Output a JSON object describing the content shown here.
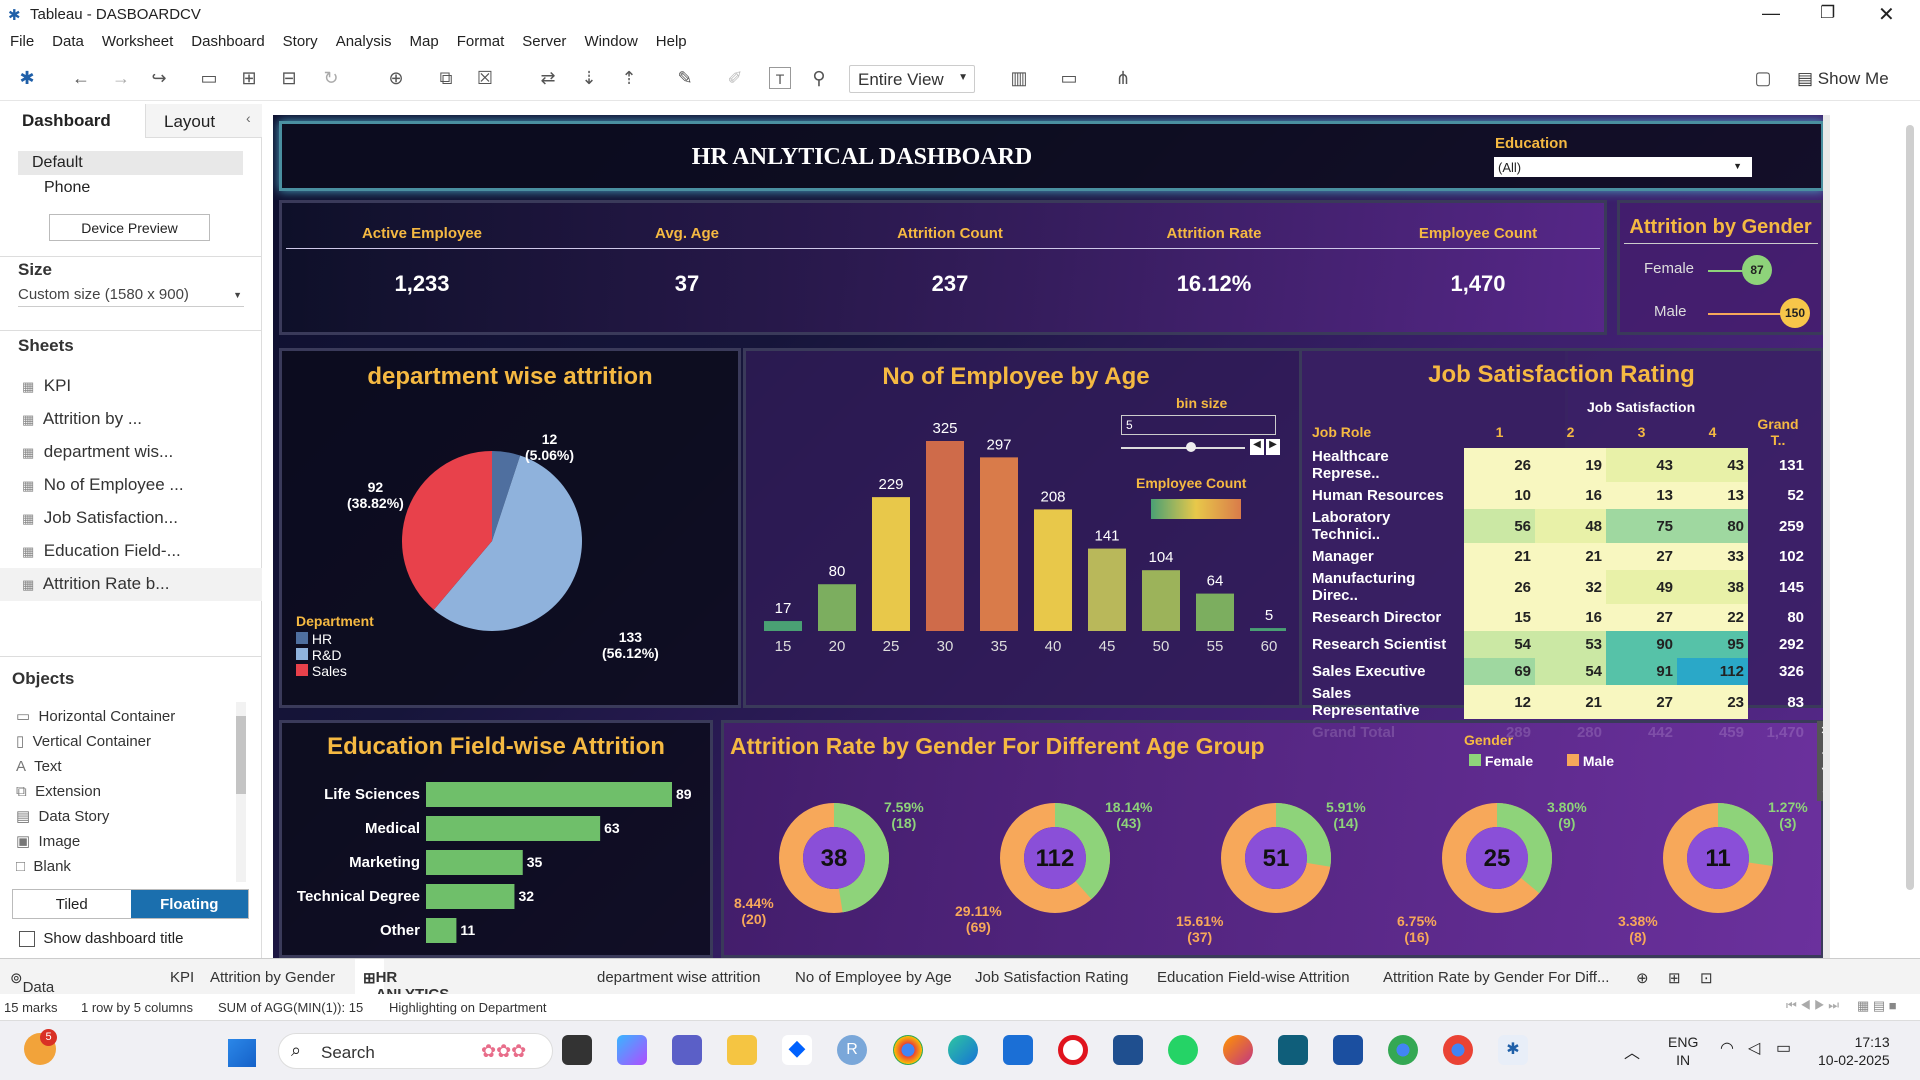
{
  "window": {
    "title": "Tableau - DASBOARDCV"
  },
  "menu": [
    "File",
    "Data",
    "Worksheet",
    "Dashboard",
    "Story",
    "Analysis",
    "Map",
    "Format",
    "Server",
    "Window",
    "Help"
  ],
  "toolbar": {
    "view_select": "Entire View",
    "show_me": "Show Me"
  },
  "left": {
    "tab_dashboard": "Dashboard",
    "tab_layout": "Layout",
    "device_default": "Default",
    "device_phone": "Phone",
    "device_preview": "Device Preview",
    "size_title": "Size",
    "size_value": "Custom size (1580 x 900)",
    "sheets_title": "Sheets",
    "sheets": [
      "KPI",
      "Attrition by ...",
      "department wis...",
      "No of Employee ...",
      "Job Satisfaction...",
      "Education Field-...",
      "Attrition Rate b..."
    ],
    "objects_title": "Objects",
    "objects": [
      "Horizontal Container",
      "Vertical Container",
      "Text",
      "Extension",
      "Data Story",
      "Image",
      "Blank"
    ],
    "tiled": "Tiled",
    "floating": "Floating",
    "show_title": "Show dashboard title"
  },
  "dashboard": {
    "title": "HR ANLYTICAL DASHBOARD",
    "education_label": "Education",
    "education_value": "(All)",
    "kpis": [
      {
        "label": "Active Employee",
        "value": "1,233"
      },
      {
        "label": "Avg. Age",
        "value": "37"
      },
      {
        "label": "Attrition Count",
        "value": "237"
      },
      {
        "label": "Attrition Rate",
        "value": "16.12%"
      },
      {
        "label": "Employee Count",
        "value": "1,470"
      }
    ],
    "gender": {
      "title": "Attrition by Gender",
      "female_label": "Female",
      "female_value": "87",
      "male_label": "Male",
      "male_value": "150"
    },
    "dept": {
      "title": "department wise attrition",
      "legend_title": "Department",
      "legend": [
        "HR",
        "R&D",
        "Sales"
      ],
      "labels": [
        {
          "n": "12",
          "p": "(5.06%)"
        },
        {
          "n": "133",
          "p": "(56.12%)"
        },
        {
          "n": "92",
          "p": "(38.82%)"
        }
      ]
    },
    "age": {
      "title": "No of Employee by Age",
      "bin_label": "bin size",
      "bin_value": "5",
      "count_label": "Employee Count"
    },
    "job": {
      "title": "Job Satisfaction Rating",
      "col_group": "Job Satisfaction",
      "col_role": "Job Role",
      "cols": [
        "1",
        "2",
        "3",
        "4",
        "Grand T.."
      ],
      "rows": [
        {
          "role": "Healthcare Represe..",
          "v": [
            "26",
            "19",
            "43",
            "43",
            "131"
          ]
        },
        {
          "role": "Human Resources",
          "v": [
            "10",
            "16",
            "13",
            "13",
            "52"
          ]
        },
        {
          "role": "Laboratory Technici..",
          "v": [
            "56",
            "48",
            "75",
            "80",
            "259"
          ]
        },
        {
          "role": "Manager",
          "v": [
            "21",
            "21",
            "27",
            "33",
            "102"
          ]
        },
        {
          "role": "Manufacturing Direc..",
          "v": [
            "26",
            "32",
            "49",
            "38",
            "145"
          ]
        },
        {
          "role": "Research Director",
          "v": [
            "15",
            "16",
            "27",
            "22",
            "80"
          ]
        },
        {
          "role": "Research Scientist",
          "v": [
            "54",
            "53",
            "90",
            "95",
            "292"
          ]
        },
        {
          "role": "Sales Executive",
          "v": [
            "69",
            "54",
            "91",
            "112",
            "326"
          ]
        },
        {
          "role": "Sales Representative",
          "v": [
            "12",
            "21",
            "27",
            "23",
            "83"
          ]
        }
      ],
      "total": {
        "role": "Grand Total",
        "v": [
          "289",
          "280",
          "442",
          "459",
          "1,470"
        ]
      }
    },
    "edu": {
      "title": "Education Field-wise Attrition"
    },
    "donut": {
      "title": "Attrition Rate by Gender For Different Age Group",
      "legend_title": "Gender",
      "female": "Female",
      "male": "Male",
      "items": [
        {
          "total": "38",
          "f_pct": "7.59%",
          "f_n": "(18)",
          "m_pct": "8.44%",
          "m_n": "(20)",
          "f_share": 0.474
        },
        {
          "total": "112",
          "f_pct": "18.14%",
          "f_n": "(43)",
          "m_pct": "29.11%",
          "m_n": "(69)",
          "f_share": 0.384
        },
        {
          "total": "51",
          "f_pct": "5.91%",
          "f_n": "(14)",
          "m_pct": "15.61%",
          "m_n": "(37)",
          "f_share": 0.275
        },
        {
          "total": "25",
          "f_pct": "3.80%",
          "f_n": "(9)",
          "m_pct": "6.75%",
          "m_n": "(16)",
          "f_share": 0.36
        },
        {
          "total": "11",
          "f_pct": "1.27%",
          "f_n": "(3)",
          "m_pct": "3.38%",
          "m_n": "(8)",
          "f_share": 0.273
        }
      ]
    }
  },
  "chart_data": [
    {
      "type": "bar",
      "title": "No of Employee by Age",
      "categories": [
        "15",
        "20",
        "25",
        "30",
        "35",
        "40",
        "45",
        "50",
        "55",
        "60"
      ],
      "values": [
        17,
        80,
        229,
        325,
        297,
        208,
        141,
        104,
        64,
        5
      ]
    },
    {
      "type": "bar",
      "title": "Education Field-wise Attrition",
      "categories": [
        "Life Sciences",
        "Medical",
        "Marketing",
        "Technical Degree",
        "Other"
      ],
      "values": [
        89,
        63,
        35,
        32,
        11
      ]
    },
    {
      "type": "pie",
      "title": "department wise attrition",
      "categories": [
        "HR",
        "R&D",
        "Sales"
      ],
      "values": [
        12,
        133,
        92
      ]
    }
  ],
  "colors": {
    "orange_title": "#f5b942",
    "female": "#8ed37a",
    "male": "#f7a85a",
    "hr": "#4f6f9f",
    "rd": "#8fb2dc",
    "sales": "#e8414b"
  },
  "tabs": [
    "Data Source",
    "KPI",
    "Attrition by Gender",
    "HR ANLYTICS DASHBOARD",
    "department wise attrition",
    "No of Employee by Age",
    "Job Satisfaction Rating",
    "Education Field-wise Attrition",
    "Attrition Rate by Gender For Diff..."
  ],
  "status": {
    "marks": "15 marks",
    "rows": "1 row by 5 columns",
    "sum": "SUM of AGG(MIN(1)): 15",
    "highlight": "Highlighting on Department"
  },
  "taskbar": {
    "search": "Search",
    "lang1": "ENG",
    "lang2": "IN",
    "time": "17:13",
    "date": "10-02-2025",
    "badge": "5"
  }
}
